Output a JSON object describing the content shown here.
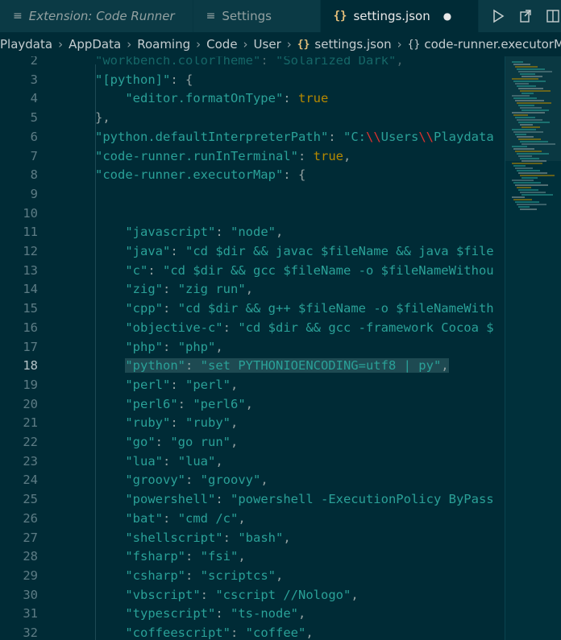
{
  "tabs": [
    {
      "icon": "≡",
      "label": "Extension: Code Runner",
      "italic": true
    },
    {
      "icon": "≡",
      "label": "Settings"
    },
    {
      "icon": "{}",
      "label": "settings.json",
      "dirty": "●"
    }
  ],
  "breadcrumb": {
    "items": [
      "Playdata",
      "AppData",
      "Roaming",
      "Code",
      "User"
    ],
    "file": "settings.json",
    "symbol": "code-runner.executorMap"
  },
  "editor": {
    "current_line": 18,
    "lines": [
      {
        "n": "2",
        "code": "\"workbench.colorTheme\": \"Solarized Dark\","
      },
      {
        "n": "3",
        "code": "\"[python]\": {"
      },
      {
        "n": "4",
        "code": "    \"editor.formatOnType\": true"
      },
      {
        "n": "5",
        "code": "},"
      },
      {
        "n": "6",
        "code": "\"python.defaultInterpreterPath\": \"C:\\\\Users\\\\Playdata"
      },
      {
        "n": "7",
        "code": "\"code-runner.runInTerminal\": true,"
      },
      {
        "n": "8",
        "code": "\"code-runner.executorMap\": {"
      },
      {
        "n": "9",
        "code": ""
      },
      {
        "n": "10",
        "code": ""
      },
      {
        "n": "11",
        "code": "    \"javascript\": \"node\","
      },
      {
        "n": "12",
        "code": "    \"java\": \"cd $dir && javac $fileName && java $file"
      },
      {
        "n": "13",
        "code": "    \"c\": \"cd $dir && gcc $fileName -o $fileNameWithou"
      },
      {
        "n": "14",
        "code": "    \"zig\": \"zig run\","
      },
      {
        "n": "15",
        "code": "    \"cpp\": \"cd $dir && g++ $fileName -o $fileNameWith"
      },
      {
        "n": "16",
        "code": "    \"objective-c\": \"cd $dir && gcc -framework Cocoa $"
      },
      {
        "n": "17",
        "code": "    \"php\": \"php\","
      },
      {
        "n": "18",
        "code": "    \"python\": \"set PYTHONIOENCODING=utf8 | py\","
      },
      {
        "n": "19",
        "code": "    \"perl\": \"perl\","
      },
      {
        "n": "20",
        "code": "    \"perl6\": \"perl6\","
      },
      {
        "n": "21",
        "code": "    \"ruby\": \"ruby\","
      },
      {
        "n": "22",
        "code": "    \"go\": \"go run\","
      },
      {
        "n": "23",
        "code": "    \"lua\": \"lua\","
      },
      {
        "n": "24",
        "code": "    \"groovy\": \"groovy\","
      },
      {
        "n": "25",
        "code": "    \"powershell\": \"powershell -ExecutionPolicy ByPass"
      },
      {
        "n": "26",
        "code": "    \"bat\": \"cmd /c\","
      },
      {
        "n": "27",
        "code": "    \"shellscript\": \"bash\","
      },
      {
        "n": "28",
        "code": "    \"fsharp\": \"fsi\","
      },
      {
        "n": "29",
        "code": "    \"csharp\": \"scriptcs\","
      },
      {
        "n": "30",
        "code": "    \"vbscript\": \"cscript //Nologo\","
      },
      {
        "n": "31",
        "code": "    \"typescript\": \"ts-node\","
      },
      {
        "n": "32",
        "code": "    \"coffeescript\": \"coffee\","
      }
    ]
  },
  "colors": {
    "background": "#002b36",
    "string": "#2aa198",
    "literal": "#b58900",
    "escape": "#dc322f",
    "line_number": "#5d7c85"
  }
}
